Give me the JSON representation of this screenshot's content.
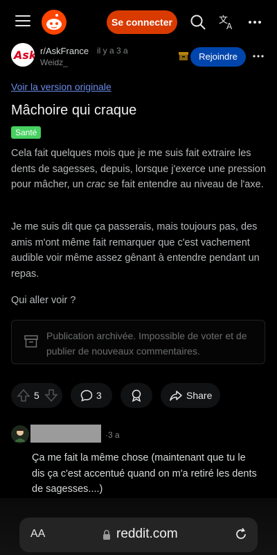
{
  "topbar": {
    "login_label": "Se connecter"
  },
  "post": {
    "subreddit": "r/AskFrance",
    "age": "il y a 3 a",
    "author": "Weidz_",
    "join_label": "Rejoindre",
    "view_original": "Voir la version originale",
    "title": "Mâchoire qui craque",
    "flair": "Santé",
    "body": {
      "p1_before": "Cela fait quelques mois que je me suis fait extraire les dents de sagesses, depuis, lorsque j'exerce une pression pour mâcher, un ",
      "p1_em": "crac",
      "p1_after": " se fait entendre au niveau de l'axe.",
      "p2": "Je me suis dit que ça passerais, mais toujours pas, des amis m'ont même fait remarquer que c'est vachement audible voir même assez gênant à entendre pendant un repas.",
      "p3": "Qui aller voir ?"
    },
    "archived_notice": "Publication archivée. Impossible de voter et de publier de nouveaux commentaires.",
    "actions": {
      "votes": "5",
      "comments": "3",
      "share": "Share"
    }
  },
  "comment": {
    "age": "·3 a",
    "body": "Ça me fait la même chose (maintenant que tu le dis ça c'est accentué quand on m'a retiré les dents de sagesses....)"
  },
  "browser": {
    "aa": "AA",
    "url": "reddit.com"
  },
  "colors": {
    "login": "#d93a00",
    "join": "#0045ac",
    "flair": "#46d160",
    "link": "#6b8dea"
  }
}
